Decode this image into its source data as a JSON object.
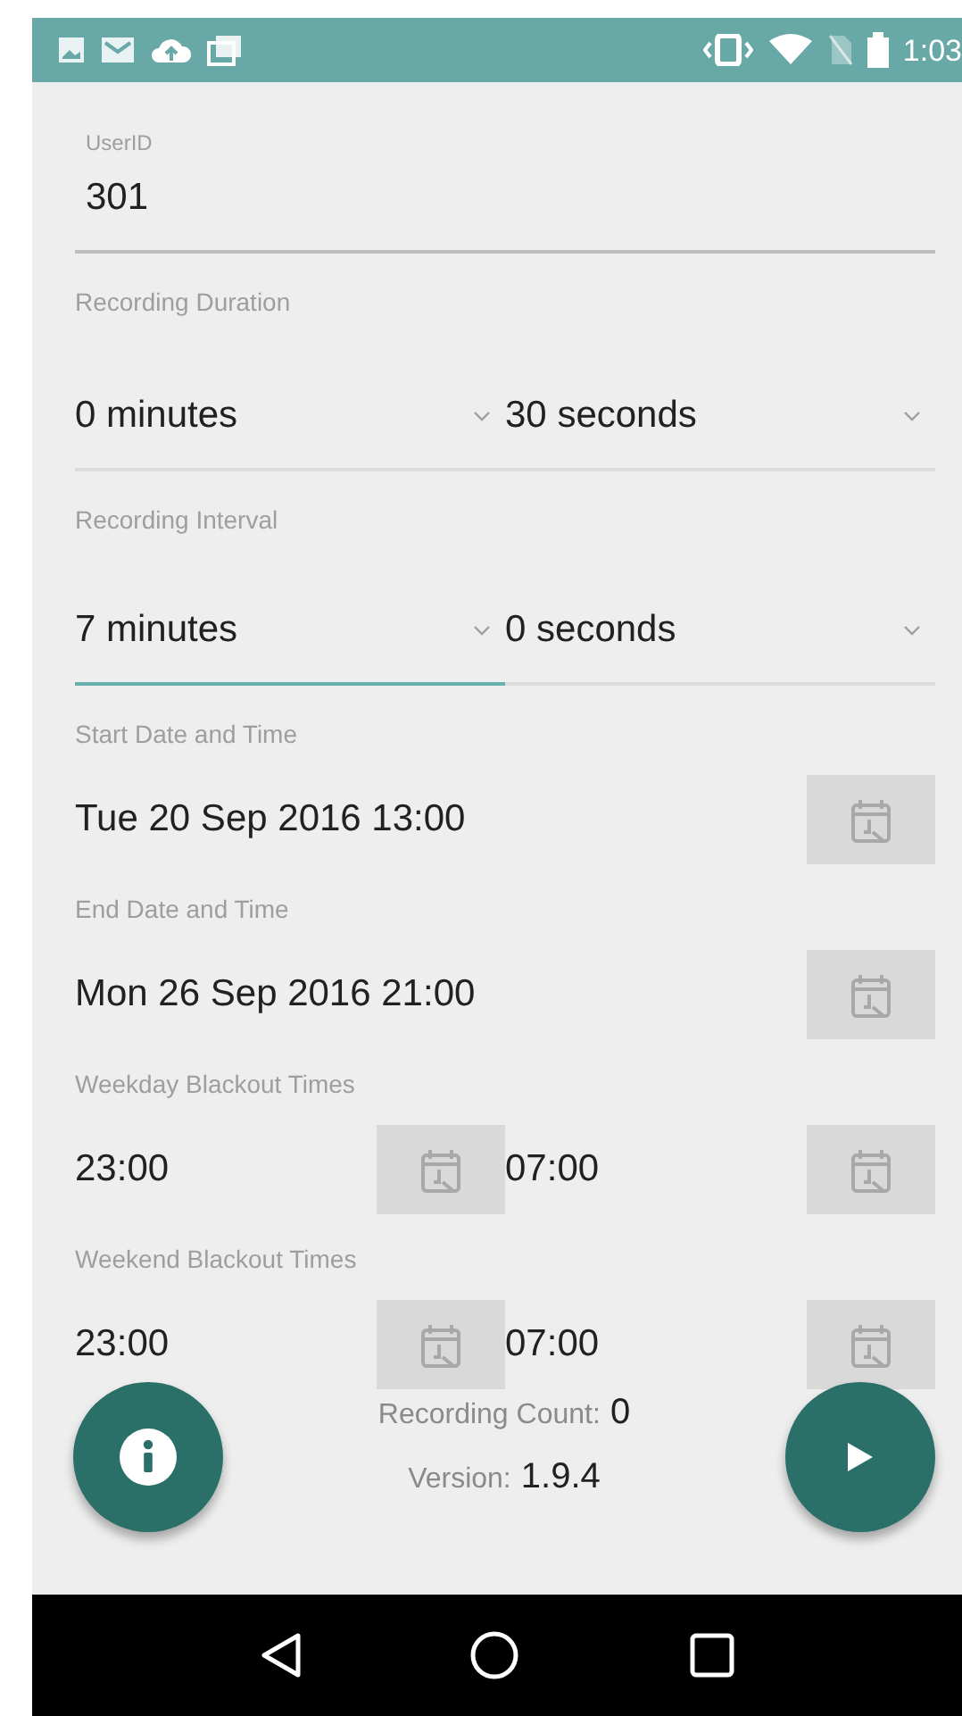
{
  "status_bar": {
    "time": "1:03"
  },
  "user_id": {
    "label": "UserID",
    "value": "301"
  },
  "spinner_groups": [
    {
      "label": "Recording Duration",
      "spinners": [
        {
          "value": "0 minutes",
          "focused": false
        },
        {
          "value": "30 seconds",
          "focused": false
        }
      ]
    },
    {
      "label": "Recording Interval",
      "spinners": [
        {
          "value": "7 minutes",
          "focused": true
        },
        {
          "value": "0 seconds",
          "focused": false
        }
      ]
    }
  ],
  "pickers": [
    {
      "label": "Start Date and Time",
      "values": [
        "Tue 20 Sep 2016 13:00"
      ]
    },
    {
      "label": "End Date and Time",
      "values": [
        "Mon 26 Sep 2016 21:00"
      ]
    },
    {
      "label": "Weekday Blackout Times",
      "values": [
        "23:00",
        "07:00"
      ]
    },
    {
      "label": "Weekend Blackout Times",
      "values": [
        "23:00",
        "07:00"
      ]
    }
  ],
  "footer": {
    "count_label": "Recording Count:",
    "count": "0",
    "version_label": "Version:",
    "version": "1.9.4"
  }
}
